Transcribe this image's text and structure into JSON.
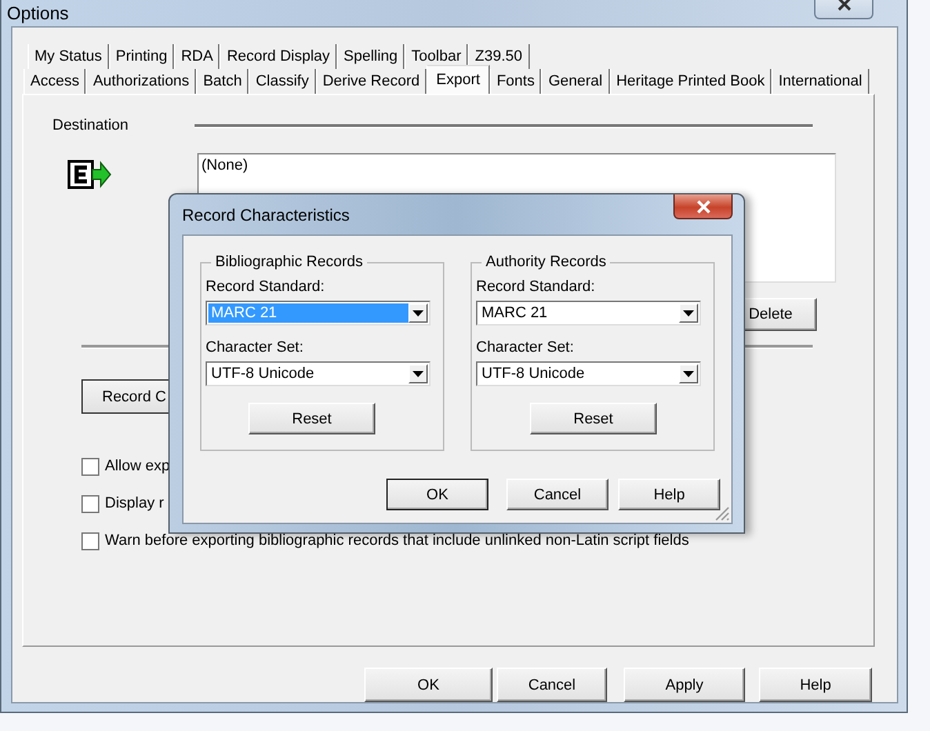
{
  "window": {
    "title": "Options"
  },
  "tab_rows": [
    [
      {
        "label": "My Status",
        "selected": false
      },
      {
        "label": "Printing",
        "selected": false
      },
      {
        "label": "RDA",
        "selected": false
      },
      {
        "label": "Record Display",
        "selected": false
      },
      {
        "label": "Spelling",
        "selected": false
      },
      {
        "label": "Toolbar",
        "selected": false
      },
      {
        "label": "Z39.50",
        "selected": false
      }
    ],
    [
      {
        "label": "Access",
        "selected": false
      },
      {
        "label": "Authorizations",
        "selected": false
      },
      {
        "label": "Batch",
        "selected": false
      },
      {
        "label": "Classify",
        "selected": false
      },
      {
        "label": "Derive Record",
        "selected": false
      },
      {
        "label": "Export",
        "selected": true
      },
      {
        "label": "Fonts",
        "selected": false
      },
      {
        "label": "General",
        "selected": false
      },
      {
        "label": "Heritage Printed Book",
        "selected": false
      },
      {
        "label": "International",
        "selected": false
      }
    ]
  ],
  "destination": {
    "label": "Destination",
    "list": [
      {
        "label": "(None)",
        "selected": false
      }
    ],
    "delete_button": "Delete"
  },
  "record_button": "Record C",
  "checkboxes": [
    {
      "label": "Allow exp",
      "checked": false
    },
    {
      "label": "Display r",
      "checked": false
    },
    {
      "label": "Warn before exporting bibliographic records that include unlinked non-Latin script fields",
      "checked": false
    }
  ],
  "buttons": [
    {
      "label": "OK",
      "default": false
    },
    {
      "label": "Cancel",
      "default": false
    },
    {
      "label": "Apply",
      "default": false
    },
    {
      "label": "Help",
      "default": false
    }
  ],
  "dialog": {
    "title": "Record Characteristics",
    "groups": [
      {
        "title": "Bibliographic Records",
        "fields": [
          {
            "label": "Record Standard:",
            "value": "MARC 21",
            "focused": true
          },
          {
            "label": "Character Set:",
            "value": "UTF-8 Unicode",
            "focused": false
          }
        ],
        "reset": "Reset"
      },
      {
        "title": "Authority Records",
        "fields": [
          {
            "label": "Record Standard:",
            "value": "MARC 21",
            "focused": false
          },
          {
            "label": "Character Set:",
            "value": "UTF-8 Unicode",
            "focused": false
          }
        ],
        "reset": "Reset"
      }
    ],
    "buttons": [
      {
        "label": "OK",
        "default": true
      },
      {
        "label": "Cancel",
        "default": false
      },
      {
        "label": "Help",
        "default": false
      }
    ]
  }
}
